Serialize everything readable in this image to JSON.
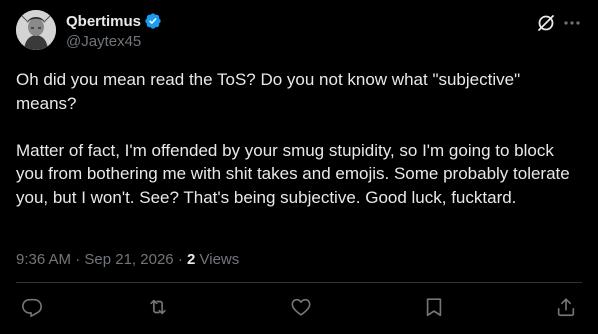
{
  "author": {
    "display_name": "Qbertimus",
    "handle": "@Jaytex45",
    "verified": true,
    "verified_color": "#1d9bf0"
  },
  "tweet": {
    "paragraphs": [
      "Oh did you mean read the ToS? Do you not know what \"subjective\" means?",
      "Matter of fact, I'm offended by your smug stupidity, so I'm going to block you from bothering me with shit takes and emojis. Some probably tolerate you, but I won't. See? That's being subjective. Good luck, fucktard."
    ],
    "time": "9:36 AM",
    "date": "Sep 21, 2026",
    "separator": "·",
    "views_count": "2",
    "views_label": "Views"
  },
  "icons": {
    "grok": "grok-icon",
    "more": "more-options-icon",
    "reply": "reply-icon",
    "retweet": "retweet-icon",
    "like": "heart-icon",
    "bookmark": "bookmark-icon",
    "share": "share-icon"
  },
  "colors": {
    "background": "#000000",
    "text_primary": "#e7e9ea",
    "text_secondary": "#71767b",
    "divider": "#2f3336"
  }
}
